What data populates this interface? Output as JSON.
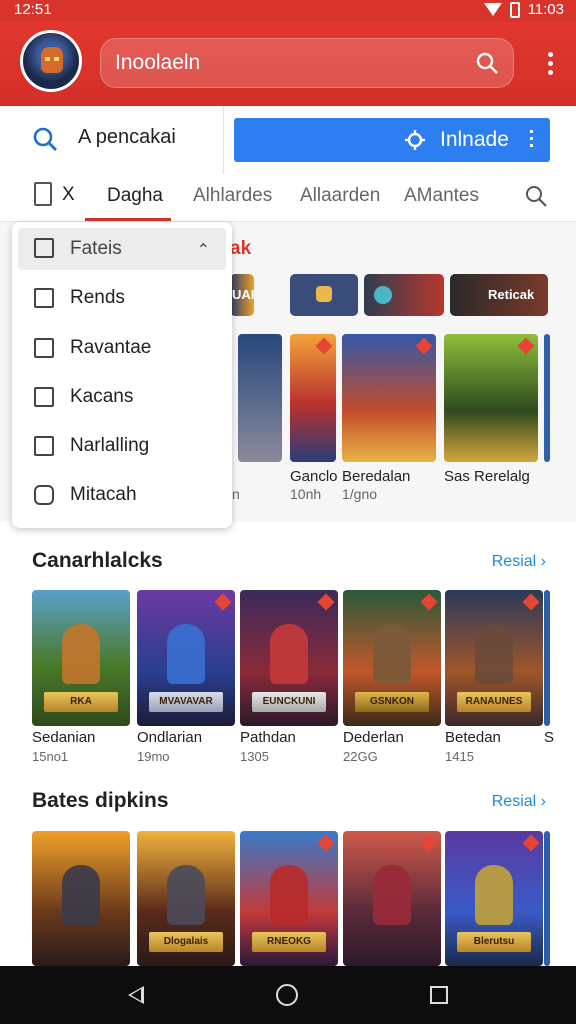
{
  "status": {
    "time": "12:51",
    "clock_right": "11:03"
  },
  "appbar": {
    "search_text": "Inoolaeln"
  },
  "search": {
    "query": "A pencakai",
    "install_label": "Inlnade"
  },
  "tabs": [
    {
      "label": "Dagha",
      "active": true
    },
    {
      "label": "Alhlardes"
    },
    {
      "label": "Allaarden"
    },
    {
      "label": "AMantes"
    }
  ],
  "tabs_close": "X",
  "dropdown": {
    "header": "Fateis",
    "items": [
      "Rends",
      "Ravantae",
      "Kacans",
      "Narlalling",
      "Mitacah"
    ]
  },
  "featured": {
    "heading": "ak",
    "banners": [
      "UAK",
      "",
      "",
      "Reticak"
    ],
    "items": [
      {
        "title": "Ganclo",
        "sub": "10nh"
      },
      {
        "title": "Beredalan",
        "sub": "1/gno"
      },
      {
        "title": "Sas Rerelalg",
        "sub": ""
      }
    ],
    "left_sub": "n"
  },
  "section1": {
    "title": "Canarhlalcks",
    "see_all": "Resial",
    "items": [
      {
        "title": "Sedanian",
        "sub": "15no1",
        "plaque": "RKA"
      },
      {
        "title": "Ondlarian",
        "sub": "19mo",
        "plaque": "MVAVAVAR"
      },
      {
        "title": "Pathdan",
        "sub": "1305",
        "plaque": "EUNCKUNI"
      },
      {
        "title": "Dederlan",
        "sub": "22GG",
        "plaque": "GSNKON"
      },
      {
        "title": "Betedan",
        "sub": "1415",
        "plaque": "RANAUNES"
      },
      {
        "title": "S",
        "sub": ""
      }
    ]
  },
  "section2": {
    "title": "Bates dipkins",
    "see_all": "Resial",
    "items": [
      {
        "plaque": ""
      },
      {
        "plaque": "Dlogalais"
      },
      {
        "plaque": "RNEOKG"
      },
      {
        "plaque": ""
      },
      {
        "plaque": "Blerutsu"
      }
    ]
  },
  "colors": {
    "brand_red": "#d9342b",
    "install_blue": "#2d7ef0",
    "link_blue": "#1e8ad6"
  }
}
